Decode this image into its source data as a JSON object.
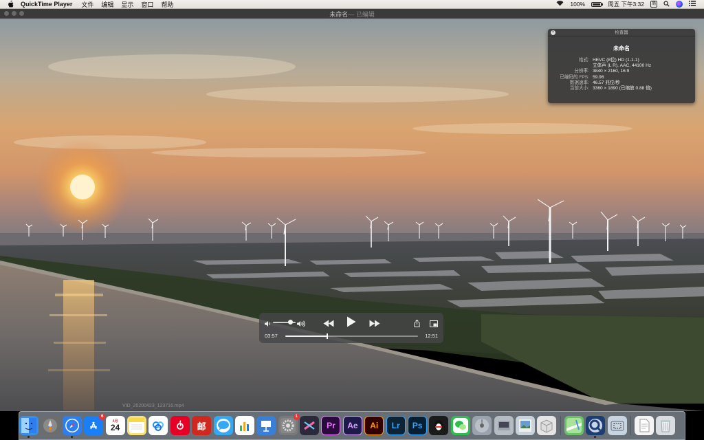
{
  "menubar": {
    "app_name": "QuickTime Player",
    "menus": [
      "文件",
      "编辑",
      "显示",
      "窗口",
      "帮助"
    ],
    "battery_text": "100%",
    "battery_level": 1.0,
    "clock": "周五 下午3:32",
    "ime_label": "简",
    "icons": [
      "apple-icon",
      "wifi-icon",
      "battery-icon",
      "ime-icon",
      "search-icon",
      "siri-icon",
      "notification-center-icon"
    ]
  },
  "window": {
    "title": "未命名",
    "subtitle": " — 已编辑"
  },
  "inspector": {
    "header": "检查器",
    "title": "未命名",
    "rows": [
      {
        "key": "格式:",
        "value": "HEVC (8位) HD (1-1-1)"
      },
      {
        "key": "",
        "value": "立体声 (L R), AAC, 44100 Hz"
      },
      {
        "key": "分辨率:",
        "value": "3840 × 2160, 16:9"
      },
      {
        "key": "已编码的 FPS:",
        "value": "59.96"
      },
      {
        "key": "数据速率:",
        "value": "46.57 兆位/秒"
      },
      {
        "key": "当前大小:",
        "value": "3360 × 1890 (已缩放 0.88 倍)"
      }
    ]
  },
  "controls": {
    "current_time": "03:57",
    "remaining_time": "12:51",
    "progress": 0.315,
    "volume": 0.75,
    "icons": [
      "volume-low-icon",
      "volume-high-icon",
      "rewind-icon",
      "play-icon",
      "fast-forward-icon",
      "share-icon",
      "picture-in-picture-icon"
    ]
  },
  "dock": {
    "file_hint": "VID_20200423_123716.mp4",
    "calendar_day": "24",
    "calendar_month": "4月",
    "badges": {
      "app-store": "6",
      "system-preferences": "1"
    },
    "apps": [
      {
        "name": "finder",
        "label": "",
        "color": "#3a8ee6",
        "running": true
      },
      {
        "name": "launchpad",
        "label": "",
        "color": "#6d6d6d",
        "running": false
      },
      {
        "name": "safari",
        "label": "",
        "color": "#2d7ff0",
        "running": true
      },
      {
        "name": "app-store",
        "label": "",
        "color": "#1a7ff5",
        "running": false
      },
      {
        "name": "calendar",
        "label": "",
        "color": "#ffffff",
        "running": false
      },
      {
        "name": "notes",
        "label": "",
        "color": "#f7e27a",
        "running": false
      },
      {
        "name": "baidu-netdisk",
        "label": "",
        "color": "#ffffff",
        "running": false
      },
      {
        "name": "netease-music",
        "label": "",
        "color": "#e60026",
        "running": false
      },
      {
        "name": "mail-163",
        "label": "邮",
        "color": "#d0281f",
        "running": false
      },
      {
        "name": "messages",
        "label": "",
        "color": "#35a8f3",
        "running": false
      },
      {
        "name": "numbers",
        "label": "",
        "color": "#ffffff",
        "running": false
      },
      {
        "name": "keynote",
        "label": "",
        "color": "#3a7fd6",
        "running": false
      },
      {
        "name": "system-preferences",
        "label": "",
        "color": "#7a7a7a",
        "running": false
      },
      {
        "name": "final-cut-pro",
        "label": "",
        "color": "#2a2a3a",
        "running": false
      },
      {
        "name": "premiere-pro",
        "label": "Pr",
        "color": "#2b0b3d",
        "running": false
      },
      {
        "name": "after-effects",
        "label": "Ae",
        "color": "#1e1a4a",
        "running": false
      },
      {
        "name": "illustrator",
        "label": "Ai",
        "color": "#330000",
        "running": false
      },
      {
        "name": "lightroom",
        "label": "Lr",
        "color": "#0c2436",
        "running": false
      },
      {
        "name": "photoshop",
        "label": "Ps",
        "color": "#071f33",
        "running": false
      },
      {
        "name": "qq",
        "label": "",
        "color": "#1b1b1b",
        "running": false
      },
      {
        "name": "wechat",
        "label": "",
        "color": "#2fbd4f",
        "running": false
      },
      {
        "name": "disk-utility",
        "label": "",
        "color": "#9aa3ad",
        "running": false
      },
      {
        "name": "network-utility",
        "label": "",
        "color": "#b6bcc4",
        "running": false
      },
      {
        "name": "preview",
        "label": "",
        "color": "#c9d2da",
        "running": false
      },
      {
        "name": "archive-utility",
        "label": "",
        "color": "#e5e5e5",
        "running": false
      },
      {
        "name": "sep",
        "label": "",
        "color": "",
        "running": false
      },
      {
        "name": "maps",
        "label": "",
        "color": "#6cc06a",
        "running": false
      },
      {
        "name": "quicktime-player",
        "label": "",
        "color": "#1d3e73",
        "running": true
      },
      {
        "name": "screenshot",
        "label": "",
        "color": "#c7d4e1",
        "running": false
      },
      {
        "name": "sep",
        "label": "",
        "color": "",
        "running": false
      },
      {
        "name": "document",
        "label": "",
        "color": "#f4f4f4",
        "running": false
      },
      {
        "name": "trash",
        "label": "",
        "color": "#d9dde2",
        "running": false
      }
    ]
  }
}
